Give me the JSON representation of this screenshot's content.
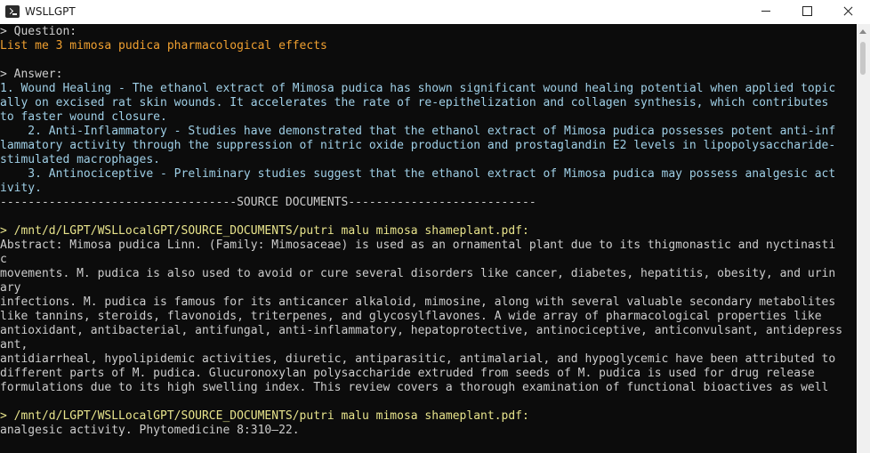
{
  "window": {
    "title": "WSLLGPT"
  },
  "question": {
    "label": "> Question:",
    "text": "List me 3 mimosa pudica pharmacological effects"
  },
  "answer": {
    "label": "> Answer:",
    "lines": [
      "1. Wound Healing - The ethanol extract of Mimosa pudica has shown significant wound healing potential when applied topic",
      "ally on excised rat skin wounds. It accelerates the rate of re-epithelization and collagen synthesis, which contributes",
      "to faster wound closure.",
      "    2. Anti-Inflammatory - Studies have demonstrated that the ethanol extract of Mimosa pudica possesses potent anti-inf",
      "lammatory activity through the suppression of nitric oxide production and prostaglandin E2 levels in lipopolysaccharide-",
      "stimulated macrophages.",
      "    3. Antinociceptive - Preliminary studies suggest that the ethanol extract of Mimosa pudica may possess analgesic act",
      "ivity."
    ]
  },
  "source_divider": "----------------------------------SOURCE DOCUMENTS---------------------------",
  "sources": [
    {
      "path": "> /mnt/d/LGPT/WSLLocalGPT/SOURCE_DOCUMENTS/putri malu mimosa shameplant.pdf:",
      "lines": [
        "Abstract: Mimosa pudica Linn. (Family: Mimosaceae) is used as an ornamental plant due to its thigmonastic and nyctinasti",
        "c",
        "movements. M. pudica is also used to avoid or cure several disorders like cancer, diabetes, hepatitis, obesity, and urin",
        "ary",
        "infections. M. pudica is famous for its anticancer alkaloid, mimosine, along with several valuable secondary metabolites",
        "like tannins, steroids, flavonoids, triterpenes, and glycosylflavones. A wide array of pharmacological properties like",
        "antioxidant, antibacterial, antifungal, anti-inflammatory, hepatoprotective, antinociceptive, anticonvulsant, antidepress",
        "ant,",
        "antidiarrheal, hypolipidemic activities, diuretic, antiparasitic, antimalarial, and hypoglycemic have been attributed to",
        "different parts of M. pudica. Glucuronoxylan polysaccharide extruded from seeds of M. pudica is used for drug release",
        "formulations due to its high swelling index. This review covers a thorough examination of functional bioactives as well"
      ]
    },
    {
      "path": "> /mnt/d/LGPT/WSLLocalGPT/SOURCE_DOCUMENTS/putri malu mimosa shameplant.pdf:",
      "lines": [
        "analgesic activity. Phytomedicine 8:310–22."
      ]
    }
  ],
  "colors": {
    "background": "#0c0c0c",
    "question_text": "#f0a030",
    "answer_text": "#9fcfe6",
    "source_path": "#e8e48c",
    "default_text": "#cccccc"
  },
  "icons": [
    "app-icon",
    "minimize-icon",
    "maximize-icon",
    "close-icon"
  ]
}
